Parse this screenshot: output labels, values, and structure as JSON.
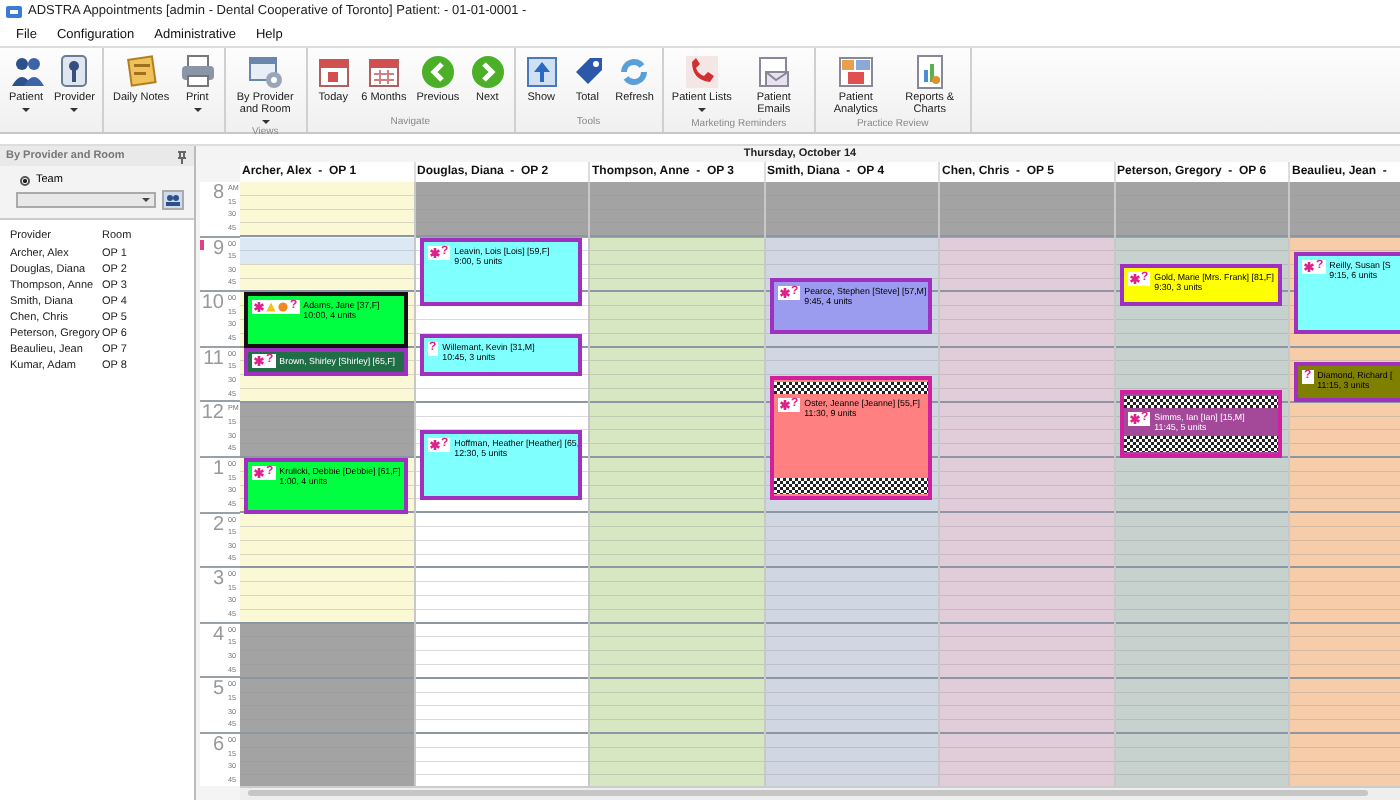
{
  "window": {
    "title": "ADSTRA Appointments [admin - Dental Cooperative of Toronto] Patient:  - 01-01-0001 -"
  },
  "menu": [
    "File",
    "Configuration",
    "Administrative",
    "Help"
  ],
  "ribbon": [
    {
      "buttons": [
        {
          "label": "Patient",
          "dropdown": true
        },
        {
          "label": "Provider",
          "dropdown": true
        }
      ]
    },
    {
      "buttons": [
        {
          "label": "Daily Notes",
          "dropdown": false
        },
        {
          "label": "Print",
          "dropdown": true
        }
      ]
    },
    {
      "label": "Views",
      "buttons": [
        {
          "label": "By Provider and Room",
          "dropdown": true
        }
      ]
    },
    {
      "label": "Navigate",
      "buttons": [
        {
          "label": "Today",
          "dropdown": false
        },
        {
          "label": "6 Months",
          "dropdown": false
        },
        {
          "label": "Previous",
          "dropdown": false
        },
        {
          "label": "Next",
          "dropdown": false
        }
      ]
    },
    {
      "label": "Tools",
      "buttons": [
        {
          "label": "Show",
          "dropdown": false
        },
        {
          "label": "Total",
          "dropdown": false
        },
        {
          "label": "Refresh",
          "dropdown": false
        }
      ]
    },
    {
      "label": "Marketing Reminders",
      "buttons": [
        {
          "label": "Patient Lists",
          "dropdown": true
        },
        {
          "label": "Patient Emails",
          "dropdown": false
        }
      ]
    },
    {
      "label": "Practice Review",
      "buttons": [
        {
          "label": "Patient Analytics",
          "dropdown": false
        },
        {
          "label": "Reports & Charts",
          "dropdown": false
        }
      ]
    }
  ],
  "sidebar": {
    "title": "By Provider and Room",
    "team": {
      "label": "Team",
      "selected": true
    },
    "columns": [
      "Provider",
      "Room"
    ],
    "rows": [
      [
        "Archer, Alex",
        "OP 1"
      ],
      [
        "Douglas, Diana",
        "OP 2"
      ],
      [
        "Thompson, Anne",
        "OP 3"
      ],
      [
        "Smith, Diana",
        "OP 4"
      ],
      [
        "Chen, Chris",
        "OP 5"
      ],
      [
        "Peterson, Gregory",
        "OP 6"
      ],
      [
        "Beaulieu, Jean",
        "OP 7"
      ],
      [
        "Kumar, Adam",
        "OP 8"
      ]
    ]
  },
  "calendar": {
    "date": "Thursday, October 14",
    "hours": [
      {
        "hour": "8",
        "marks": [
          "AM",
          "15",
          "30",
          "45"
        ],
        "current": false
      },
      {
        "hour": "9",
        "marks": [
          "00",
          "15",
          "30",
          "45"
        ],
        "current": true
      },
      {
        "hour": "10",
        "marks": [
          "00",
          "15",
          "30",
          "45"
        ],
        "current": false
      },
      {
        "hour": "11",
        "marks": [
          "00",
          "15",
          "30",
          "45"
        ],
        "current": false
      },
      {
        "hour": "12",
        "marks": [
          "PM",
          "15",
          "30",
          "45"
        ],
        "current": false
      },
      {
        "hour": "1",
        "marks": [
          "00",
          "15",
          "30",
          "45"
        ],
        "current": false
      },
      {
        "hour": "2",
        "marks": [
          "00",
          "15",
          "30",
          "45"
        ],
        "current": false
      },
      {
        "hour": "3",
        "marks": [
          "00",
          "15",
          "30",
          "45"
        ],
        "current": false
      },
      {
        "hour": "4",
        "marks": [
          "00",
          "15",
          "30",
          "45"
        ],
        "current": false
      },
      {
        "hour": "5",
        "marks": [
          "00",
          "15",
          "30",
          "45"
        ],
        "current": false
      },
      {
        "hour": "6",
        "marks": [
          "00",
          "15",
          "30",
          "45"
        ],
        "current": false
      }
    ],
    "columns": [
      {
        "header": "Archer, Alex  -  OP 1",
        "color": "#fbf8d6",
        "hours": [
          {
            "closed": false,
            "selected": false
          },
          {
            "closed": false,
            "selected": true
          },
          {
            "closed": false,
            "selected": false
          },
          {
            "closed": false,
            "selected": false
          },
          {
            "closed": true,
            "selected": false
          },
          {
            "closed": false,
            "selected": false
          },
          {
            "closed": false,
            "selected": false
          },
          {
            "closed": false,
            "selected": false
          },
          {
            "closed": true,
            "selected": false
          },
          {
            "closed": true,
            "selected": false
          },
          {
            "closed": true,
            "selected": false
          }
        ],
        "appointments": [
          {
            "kind": "alert",
            "name": "Adams, Jane [37,F]",
            "detail": "10:00, 4 units",
            "color": "#00ff40",
            "mark": "?"
          },
          {
            "kind": "standard",
            "name": "Brown, Shirley [Shirley] [65,F]",
            "color": "#1f6e45",
            "mark": "?"
          },
          {
            "kind": "standard",
            "name": "Krulicki, Debbie [Debbie] [61,F]",
            "detail": "1:00, 4 units",
            "color": "#00ff40",
            "mark": "?"
          }
        ]
      },
      {
        "header": "Douglas, Diana  -  OP 2",
        "color": "#ffffff",
        "hours": [
          {
            "closed": true,
            "selected": false
          },
          {
            "closed": false,
            "selected": false
          },
          {
            "closed": false,
            "selected": false
          },
          {
            "closed": false,
            "selected": false
          },
          {
            "closed": false,
            "selected": false
          },
          {
            "closed": false,
            "selected": false
          },
          {
            "closed": false,
            "selected": false
          },
          {
            "closed": false,
            "selected": false
          },
          {
            "closed": false,
            "selected": false
          },
          {
            "closed": false,
            "selected": false
          },
          {
            "closed": false,
            "selected": false
          }
        ],
        "appointments": [
          {
            "kind": "standard",
            "name": "Leavin, Lois [Lois] [59,F]",
            "detail": "9:00, 5 units",
            "color": "#80ffff",
            "mark": "?"
          },
          {
            "kind": "plain",
            "name": "Willemant, Kevin [31,M]",
            "detail": "10:45, 3 units",
            "color": "#80ffff",
            "mark": "?"
          },
          {
            "kind": "standard",
            "name": "Hoffman, Heather [Heather] [65,",
            "detail": "12:30, 5 units",
            "color": "#80ffff",
            "mark": "?"
          }
        ]
      },
      {
        "header": "Thompson, Anne  -  OP 3",
        "color": "#d6e7c1",
        "hours": [
          {
            "closed": true,
            "selected": false
          },
          {
            "closed": false,
            "selected": false
          },
          {
            "closed": false,
            "selected": false
          },
          {
            "closed": false,
            "selected": false
          },
          {
            "closed": false,
            "selected": false
          },
          {
            "closed": false,
            "selected": false
          },
          {
            "closed": false,
            "selected": false
          },
          {
            "closed": false,
            "selected": false
          },
          {
            "closed": false,
            "selected": false
          },
          {
            "closed": false,
            "selected": false
          },
          {
            "closed": false,
            "selected": false
          }
        ]
      },
      {
        "header": "Smith, Diana  -  OP 4",
        "color": "#d1d7e2",
        "hours": [
          {
            "closed": true,
            "selected": false
          },
          {
            "closed": false,
            "selected": false
          },
          {
            "closed": false,
            "selected": false
          },
          {
            "closed": false,
            "selected": false
          },
          {
            "closed": false,
            "selected": false
          },
          {
            "closed": false,
            "selected": false
          },
          {
            "closed": false,
            "selected": false
          },
          {
            "closed": false,
            "selected": false
          },
          {
            "closed": false,
            "selected": false
          },
          {
            "closed": false,
            "selected": false
          },
          {
            "closed": false,
            "selected": false
          }
        ],
        "appointments": [
          {
            "kind": "standard",
            "name": "Pearce, Stephen [Steve] [57,M]",
            "detail": "9:45, 4 units",
            "color": "#9b9bf0",
            "mark": "?"
          },
          {
            "kind": "blocked",
            "name": "Oster, Jeanne [Jeanne] [55,F]",
            "detail": "11:30, 9 units",
            "color": "#ff8080",
            "mark": "?"
          }
        ]
      },
      {
        "header": "Chen, Chris  -  OP 5",
        "color": "#e1cdd9",
        "hours": [
          {
            "closed": true,
            "selected": false
          },
          {
            "closed": false,
            "selected": false
          },
          {
            "closed": false,
            "selected": false
          },
          {
            "closed": false,
            "selected": false
          },
          {
            "closed": false,
            "selected": false
          },
          {
            "closed": false,
            "selected": false
          },
          {
            "closed": false,
            "selected": false
          },
          {
            "closed": false,
            "selected": false
          },
          {
            "closed": false,
            "selected": false
          },
          {
            "closed": false,
            "selected": false
          },
          {
            "closed": false,
            "selected": false
          }
        ]
      },
      {
        "header": "Peterson, Gregory  -  OP 6",
        "color": "#c7d1cd",
        "hours": [
          {
            "closed": true,
            "selected": false
          },
          {
            "closed": false,
            "selected": false
          },
          {
            "closed": false,
            "selected": false
          },
          {
            "closed": false,
            "selected": false
          },
          {
            "closed": false,
            "selected": false
          },
          {
            "closed": false,
            "selected": false
          },
          {
            "closed": false,
            "selected": false
          },
          {
            "closed": false,
            "selected": false
          },
          {
            "closed": false,
            "selected": false
          },
          {
            "closed": false,
            "selected": false
          },
          {
            "closed": false,
            "selected": false
          }
        ],
        "appointments": [
          {
            "kind": "standard",
            "name": "Gold, Marie [Mrs. Frank] [81,F]",
            "detail": "9:30, 3 units",
            "color": "#ffff00",
            "mark": "?"
          },
          {
            "kind": "blocked",
            "name": "Simms, Ian [Ian] [15,M]",
            "detail": "11:45, 5 units",
            "color": "#a4489a",
            "mark": "?"
          }
        ]
      },
      {
        "header": "Beaulieu, Jean  -",
        "color": "#f6cda8",
        "hours": [
          {
            "closed": true,
            "selected": false
          },
          {
            "closed": false,
            "selected": false
          },
          {
            "closed": false,
            "selected": false
          },
          {
            "closed": false,
            "selected": false
          },
          {
            "closed": false,
            "selected": false
          },
          {
            "closed": false,
            "selected": false
          },
          {
            "closed": false,
            "selected": false
          },
          {
            "closed": false,
            "selected": false
          },
          {
            "closed": false,
            "selected": false
          },
          {
            "closed": false,
            "selected": false
          },
          {
            "closed": false,
            "selected": false
          }
        ],
        "appointments": [
          {
            "kind": "standard",
            "name": "Reilly, Susan [S",
            "detail": "9:15, 6 units",
            "color": "#80ffff",
            "mark": "?"
          },
          {
            "kind": "plain",
            "name": "Diamond, Richard [",
            "detail": "11:15, 3 units",
            "color": "#808000",
            "mark": "?"
          }
        ]
      }
    ]
  }
}
